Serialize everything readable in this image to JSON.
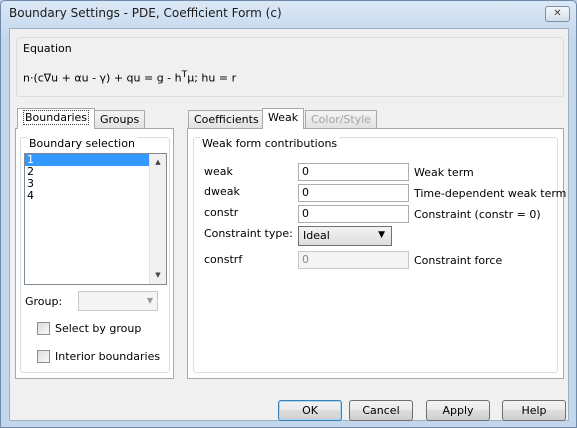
{
  "window": {
    "title": "Boundary Settings - PDE, Coefficient Form (c)"
  },
  "equation": {
    "label": "Equation",
    "formula_pre": "n·(c∇u + αu - γ) + qu = g - h",
    "formula_sup": "T",
    "formula_post": "μ; hu = r"
  },
  "left_tabs": {
    "boundaries": "Boundaries",
    "groups": "Groups"
  },
  "boundary_selection": {
    "label": "Boundary selection",
    "items": [
      "1",
      "2",
      "3",
      "4"
    ],
    "selected_index": 0,
    "group_label": "Group:",
    "group_value": "",
    "select_by_group": {
      "label": "Select by group",
      "checked": false
    },
    "interior_boundaries": {
      "label": "Interior boundaries",
      "checked": false
    }
  },
  "right_tabs": {
    "coefficients": "Coefficients",
    "weak": "Weak",
    "color_style": "Color/Style"
  },
  "weak_form": {
    "group_label": "Weak form contributions",
    "rows": {
      "weak": {
        "name": "weak",
        "value": "0",
        "desc": "Weak term"
      },
      "dweak": {
        "name": "dweak",
        "value": "0",
        "desc": "Time-dependent weak term"
      },
      "constr": {
        "name": "constr",
        "value": "0",
        "desc": "Constraint (constr = 0)"
      }
    },
    "constraint_type": {
      "label": "Constraint type:",
      "value": "Ideal"
    },
    "constrf": {
      "name": "constrf",
      "value": "0",
      "desc": "Constraint force"
    }
  },
  "buttons": {
    "ok": "OK",
    "cancel": "Cancel",
    "apply": "Apply",
    "help": "Help"
  }
}
